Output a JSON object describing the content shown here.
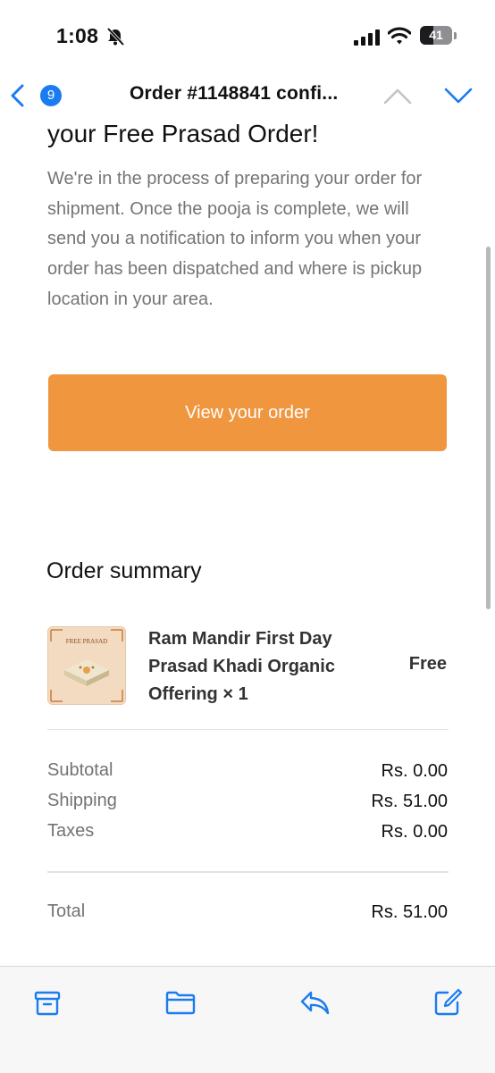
{
  "status_bar": {
    "time": "1:08",
    "battery_text": "41",
    "battery_level": 0.41,
    "icons": [
      "bell-slash-icon",
      "signal-icon",
      "wifi-icon",
      "battery-icon"
    ]
  },
  "nav": {
    "unread_count": "9",
    "title": "Order #1148841 confi...",
    "icons": [
      "back-chevron-icon",
      "chevron-up-icon",
      "chevron-down-icon"
    ]
  },
  "email": {
    "heading": "your Free Prasad Order!",
    "intro": "We're in the process of preparing your order for shipment. Once the pooja is complete, we will send you a notification to inform you when your order has been dispatched and where is pickup location in your area.",
    "view_order_label": "View your order",
    "summary_title": "Order summary",
    "item": {
      "thumb_caption": "FREE PRASAD",
      "name": "Ram Mandir First Day Prasad Khadi Organic Offering × 1",
      "price": "Free"
    },
    "totals": [
      {
        "label": "Subtotal",
        "value": "Rs. 0.00"
      },
      {
        "label": "Shipping",
        "value": "Rs. 51.00"
      },
      {
        "label": "Taxes",
        "value": "Rs. 0.00"
      }
    ],
    "grand_total": {
      "label": "Total",
      "value": "Rs. 51.00"
    }
  },
  "colors": {
    "accent_blue": "#1a7cf0",
    "button_orange": "#f0963f",
    "muted_text": "#757575"
  },
  "toolbar": {
    "icons": [
      "archive-icon",
      "folder-icon",
      "reply-icon",
      "compose-icon"
    ]
  }
}
